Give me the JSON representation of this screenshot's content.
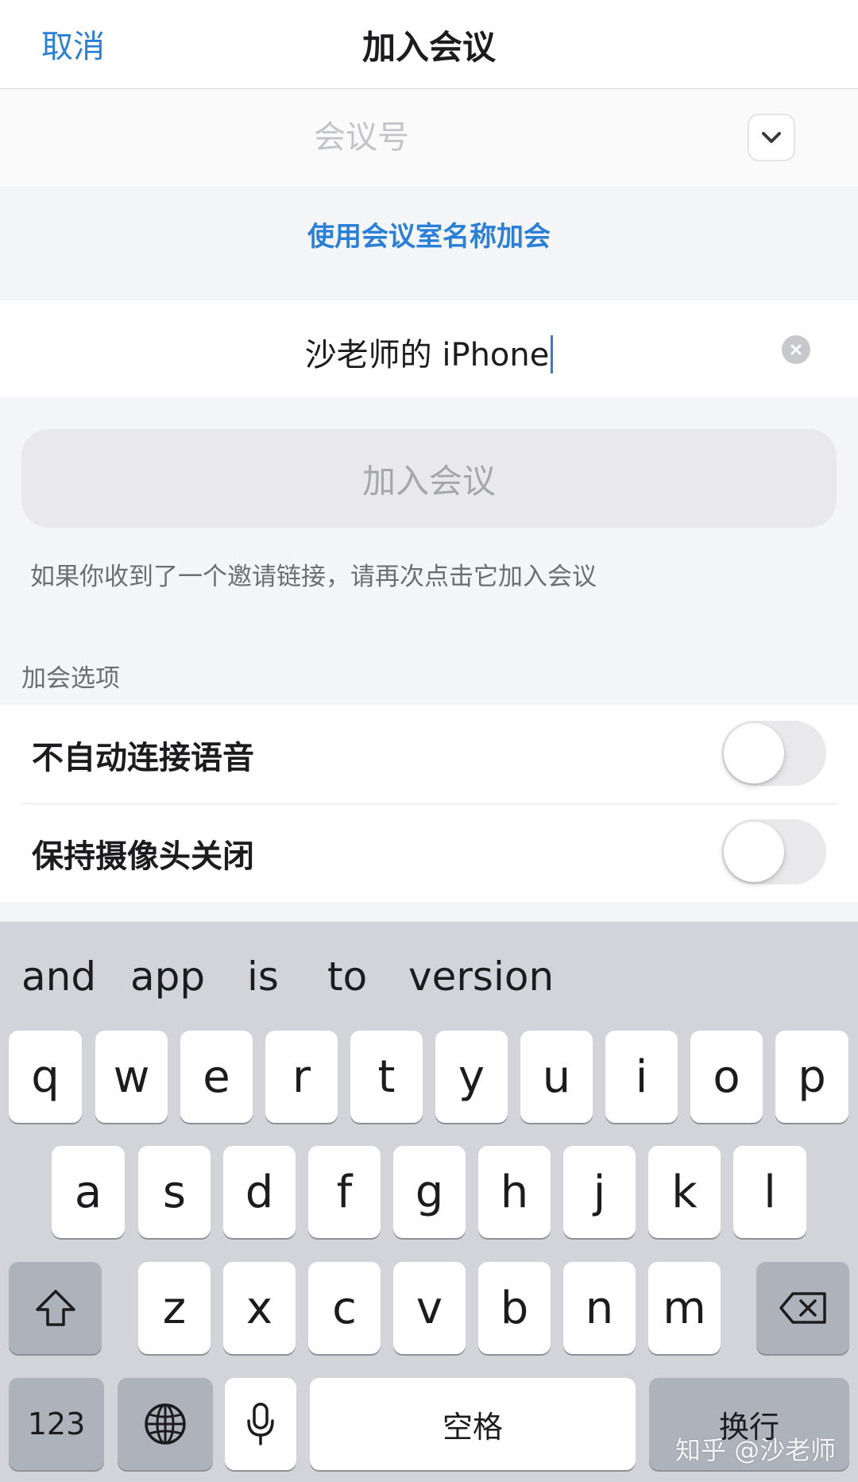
{
  "header": {
    "cancel_label": "取消",
    "title": "加入会议"
  },
  "meeting_id": {
    "placeholder": "会议号",
    "value": ""
  },
  "room_name_link": "使用会议室名称加会",
  "display_name": {
    "value": "沙老师的 iPhone"
  },
  "join_button_label": "加入会议",
  "hint": "如果你收到了一个邀请链接，请再次点击它加入会议",
  "options": {
    "section_label": "加会选项",
    "items": [
      {
        "label": "不自动连接语音",
        "enabled": false
      },
      {
        "label": "保持摄像头关闭",
        "enabled": false
      }
    ]
  },
  "keyboard": {
    "suggestions": [
      "and",
      "app",
      "is",
      "to",
      "version"
    ],
    "row1": [
      "q",
      "w",
      "e",
      "r",
      "t",
      "y",
      "u",
      "i",
      "o",
      "p"
    ],
    "row2": [
      "a",
      "s",
      "d",
      "f",
      "g",
      "h",
      "j",
      "k",
      "l"
    ],
    "row3": [
      "z",
      "x",
      "c",
      "v",
      "b",
      "n",
      "m"
    ],
    "numbers_label": "123",
    "space_label": "空格",
    "return_label": "换行",
    "icons": [
      "shift-icon",
      "backspace-icon",
      "globe-icon",
      "microphone-icon"
    ]
  },
  "watermark": "知乎 @沙老师",
  "colors": {
    "accent": "#2a7fd8",
    "toggle_off": "#e9e9eb",
    "keyboard_bg": "#d2d4da"
  }
}
